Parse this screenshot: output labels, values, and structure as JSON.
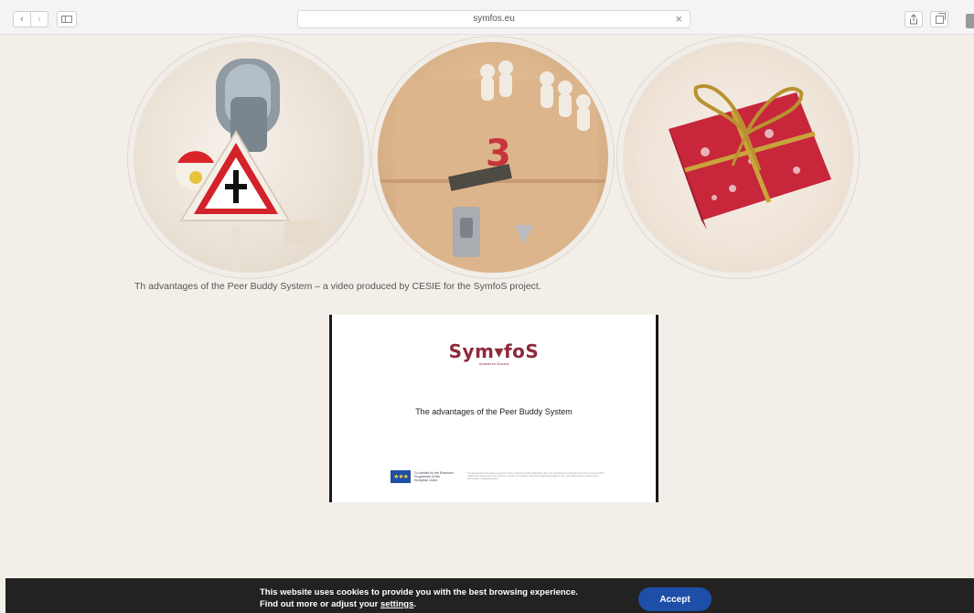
{
  "browser": {
    "url": "symfos.eu",
    "back_icon": "‹",
    "forward_icon": "›",
    "close_icon": "×"
  },
  "page": {
    "caption": "Th advantages of the Peer Buddy System – a video produced by CESIE for the SymfoS project.",
    "video": {
      "logo_text": "Sym▾foS",
      "logo_sub": "Symbols for Success",
      "title": "The advantages of the Peer Buddy System",
      "eu_text": "Co-funded by the Erasmus+ Programme of the European Union",
      "disclaimer": "The European Commission support for the production of this publication does not constitute an endorsement of the contents which reflects the views only of the authors, and the Commission cannot be held responsible for any use which may be made of the information contained therein."
    }
  },
  "cookie": {
    "line1": "This website uses cookies to provide you with the best browsing experience.",
    "line2_prefix": "Find out more or adjust your ",
    "settings_link": "settings",
    "line2_suffix": ".",
    "accept_label": "Accept"
  },
  "colors": {
    "page_bg": "#f3efe8",
    "brand_maroon": "#8e2a3b",
    "accept_blue": "#1d4fa8",
    "cookie_bg": "#222222"
  }
}
